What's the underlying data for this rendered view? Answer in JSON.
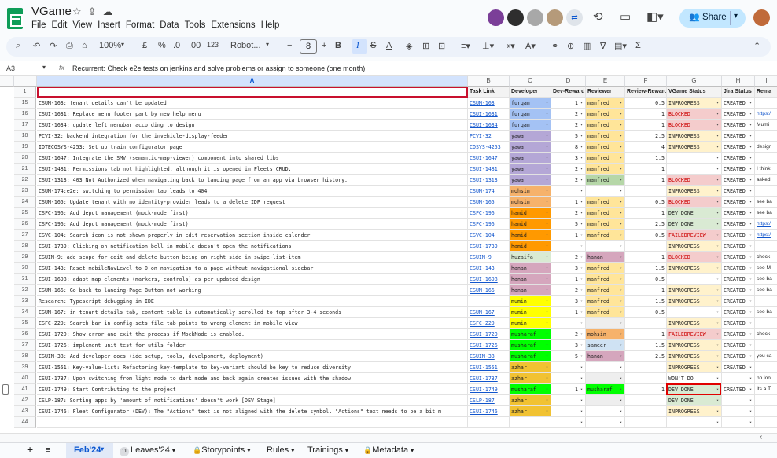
{
  "app": {
    "doc_title": "VGame",
    "menu": [
      "File",
      "Edit",
      "View",
      "Insert",
      "Format",
      "Data",
      "Tools",
      "Extensions",
      "Help"
    ],
    "share_label": "Share"
  },
  "toolbar": {
    "zoom": "100%",
    "currency": "£",
    "percent": "%",
    "decimals_dec": ".0",
    "decimals_inc": ".00",
    "number_format": "123",
    "font": "Robot...",
    "font_size": "8"
  },
  "formula_bar": {
    "cell_ref": "A3",
    "fx": "fx",
    "content": "Recurrent: Check e2e tests on jenkins and solve problems or assign to someone (one month)"
  },
  "columns": [
    "A",
    "B",
    "C",
    "D",
    "E",
    "F",
    "G",
    "H",
    "I"
  ],
  "header_row": {
    "row_num": "1",
    "task_link": "Task Link",
    "developer": "Developer",
    "dev_reward": "Dev-Reward",
    "reviewer": "Reviewer",
    "review_reward": "Review-Reward",
    "vgame_status": "VGame Status",
    "jira_status": "Jira Status",
    "remarks": "Rema"
  },
  "rows": [
    {
      "n": "15",
      "a": "CSUM-163: tenant details can't be updated",
      "b": "CSUM-163",
      "c": "furqan",
      "d": "1",
      "e": "manfred",
      "f": "0.5",
      "g": "INPROGRESS",
      "h": "CREATED",
      "i": ""
    },
    {
      "n": "16",
      "a": "CSUI-1631: Replace menu footer part by new help menu",
      "b": "CSUI-1631",
      "c": "furqan",
      "d": "2",
      "e": "manfred",
      "f": "1",
      "g": "BLOCKED",
      "h": "CREATED",
      "i": "https:/"
    },
    {
      "n": "17",
      "a": "CSUI-1634: update left menubar according to design",
      "b": "CSUI-1634",
      "c": "furqan",
      "d": "2",
      "e": "manfred",
      "f": "1",
      "g": "BLOCKED",
      "h": "CREATED",
      "i": "Mumi"
    },
    {
      "n": "18",
      "a": "PCVI-32: backend integration for the invehicle-display-feeder",
      "b": "PCVI-32",
      "c": "yawar",
      "d": "5",
      "e": "manfred",
      "f": "2.5",
      "g": "INPROGRESS",
      "h": "CREATED",
      "i": ""
    },
    {
      "n": "19",
      "a": "IOTECOSYS-4253: Set up train configurator page",
      "b": "COSYS-4253",
      "c": "yawar",
      "d": "8",
      "e": "manfred",
      "f": "4",
      "g": "INPROGRESS",
      "h": "CREATED",
      "i": "design"
    },
    {
      "n": "20",
      "a": "CSUI-1647: Integrate the SMV (semantic-map-viewer) component into shared libs",
      "b": "CSUI-1647",
      "c": "yawar",
      "d": "3",
      "e": "manfred",
      "f": "1.5",
      "g": "",
      "h": "CREATED",
      "i": ""
    },
    {
      "n": "21",
      "a": "CSUI-1481: Permissions tab not highlighted, although it is opened in Fleets CRUD.",
      "b": "CSUI-1481",
      "c": "yawar",
      "d": "2",
      "e": "manfred",
      "f": "1",
      "g": "",
      "h": "CREATED",
      "i": "I think"
    },
    {
      "n": "22",
      "a": "CSUI-1313: 403 Not Authorized when navigating back to landing page from an app via browser history.",
      "b": "CSUI-1313",
      "c": "yawar",
      "d": "2",
      "e": "manfred",
      "f": "1",
      "g": "BLOCKED",
      "h": "CREATED",
      "i": "asked"
    },
    {
      "n": "23",
      "a": "CSUM-174:e2e: switching to permission tab leads to 404",
      "b": "CSUM-174",
      "c": "mohsin",
      "d": "",
      "e": "",
      "f": "",
      "g": "INPROGRESS",
      "h": "CREATED",
      "i": ""
    },
    {
      "n": "24",
      "a": "CSUM-165: Update tenant with no identity-provider leads to a delete IDP request",
      "b": "CSUM-165",
      "c": "mohsin",
      "d": "1",
      "e": "manfred",
      "f": "0.5",
      "g": "BLOCKED",
      "h": "CREATED",
      "i": "see ba"
    },
    {
      "n": "25",
      "a": "CSFC-196: Add depot management (mock-mode first)",
      "b": "CSFC-196",
      "c": "hamid",
      "d": "2",
      "e": "manfred",
      "f": "1",
      "g": "DEV DONE",
      "h": "CREATED",
      "i": "see ba"
    },
    {
      "n": "26",
      "a": "CSFC-196: Add depot management (mock-mode first)",
      "b": "CSFC-196",
      "c": "hamid",
      "d": "5",
      "e": "manfred",
      "f": "2.5",
      "g": "DEV DONE",
      "h": "CREATED",
      "i": "https:/"
    },
    {
      "n": "27",
      "a": "CSVC-104: Search icon is not shown properly in edit reservation section inside calender",
      "b": "CSVC-104",
      "c": "hamid",
      "d": "1",
      "e": "manfred",
      "f": "0.5",
      "g": "FAILEDREVIEW",
      "h": "CREATED",
      "i": "https:/"
    },
    {
      "n": "28",
      "a": "CSUI-1739: Clicking on notification bell in mobile doesn't open the notifications",
      "b": "CSUI-1739",
      "c": "hamid",
      "d": "",
      "e": "",
      "f": "",
      "g": "INPROGRESS",
      "h": "CREATED",
      "i": ""
    },
    {
      "n": "29",
      "a": "CSUIM-9: add scope for edit and delete button being on right side in swipe-list-item",
      "b": "CSUIM-9",
      "c": "huzaifa",
      "d": "2",
      "e": "hanan",
      "f": "1",
      "g": "BLOCKED",
      "h": "CREATED",
      "i": "check"
    },
    {
      "n": "30",
      "a": "CSUI-143: Reset mobileNavLevel to 0 on navigation to a page without navigational sidebar",
      "b": "CSUI-143",
      "c": "hanan",
      "d": "3",
      "e": "manfred",
      "f": "1.5",
      "g": "INPROGRESS",
      "h": "CREATED",
      "i": "see M"
    },
    {
      "n": "31",
      "a": "CSUI-1698: adapt map elements (markers, controls) as per updated design",
      "b": "CSUI-1698",
      "c": "hanan",
      "d": "1",
      "e": "manfred",
      "f": "0.5",
      "g": "",
      "h": "CREATED",
      "i": "see ba"
    },
    {
      "n": "32",
      "a": "CSUM-166: Go back to landing-Page Button not working",
      "b": "CSUM-166",
      "c": "hanan",
      "d": "2",
      "e": "manfred",
      "f": "1",
      "g": "INPROGRESS",
      "h": "CREATED",
      "i": "see ba"
    },
    {
      "n": "33",
      "a": "Research: Typescript debugging in IDE",
      "b": "",
      "c": "mumin",
      "d": "3",
      "e": "manfred",
      "f": "1.5",
      "g": "INPROGRESS",
      "h": "CREATED",
      "i": ""
    },
    {
      "n": "34",
      "a": "CSUM-167: in tenant details tab, content table is automatically scrolled to top after 3-4 seconds",
      "b": "CSUM-167",
      "c": "mumin",
      "d": "1",
      "e": "manfred",
      "f": "0.5",
      "g": "",
      "h": "CREATED",
      "i": "see ba"
    },
    {
      "n": "35",
      "a": "CSFC-229: Search bar in config-sets file tab points to wrong element in mobile view",
      "b": "CSFC-229",
      "c": "mumin",
      "d": "",
      "e": "",
      "f": "",
      "g": "INPROGRESS",
      "h": "CREATED",
      "i": ""
    },
    {
      "n": "36",
      "a": "CSUI-1720: Show error and exit the process if MockMode is enabled.",
      "b": "CSUI-1720",
      "c": "musharaf",
      "d": "2",
      "e": "mohsin",
      "f": "1",
      "g": "FAILEDREVIEW",
      "h": "CREATED",
      "i": "check"
    },
    {
      "n": "37",
      "a": "CSUI-1726: implement unit test for utils folder",
      "b": "CSUI-1726",
      "c": "musharaf",
      "d": "3",
      "e": "sameer",
      "f": "1.5",
      "g": "INPROGRESS",
      "h": "CREATED",
      "i": ""
    },
    {
      "n": "38",
      "a": "CSUIM-38: Add developer docs (ide setup, tools, develpoment, deployment)",
      "b": "CSUIM-38",
      "c": "musharaf",
      "d": "5",
      "e": "hanan",
      "f": "2.5",
      "g": "INPROGRESS",
      "h": "CREATED",
      "i": "you ca"
    },
    {
      "n": "39",
      "a": "CSUI-1551: Key-value-list: Refactoring key-template to key-variant should be key to reduce diversity",
      "b": "CSUI-1551",
      "c": "azhar",
      "d": "",
      "e": "",
      "f": "",
      "g": "INPROGRESS",
      "h": "CREATED",
      "i": ""
    },
    {
      "n": "40",
      "a": "CSUI-1737: Upon switching from light mode to dark mode and back again creates issues with the shadow",
      "b": "CSUI-1737",
      "c": "azhar",
      "d": "",
      "e": "",
      "f": "",
      "g": "WON'T DO",
      "h": "",
      "i": "no lon"
    },
    {
      "n": "41",
      "a": "CSUI-1749: Start Contributing to the project",
      "b": "CSUI-1749",
      "c": "musharaf",
      "d": "1",
      "e": "musharaf",
      "f": "1",
      "g": "DEV DONE",
      "h": "CREATED",
      "i": "Its a T"
    },
    {
      "n": "42",
      "a": "CSLP-187: Sorting apps by 'amount of notifications' doesn't work [DEV Stage]",
      "b": "CSLP-187",
      "c": "azhar",
      "d": "",
      "e": "",
      "f": "",
      "g": "DEV DONE",
      "h": "",
      "i": ""
    },
    {
      "n": "43",
      "a": "CSUI-1746: Fleet Configurator (DEV): The \"Actions\" text is not aligned with the delete symbol. \"Actions\" text needs to be a bit m",
      "b": "CSUI-1746",
      "c": "azhar",
      "d": "",
      "e": "",
      "f": "",
      "g": "INPROGRESS",
      "h": "",
      "i": ""
    },
    {
      "n": "44",
      "a": "",
      "b": "",
      "c": "",
      "d": "",
      "e": "",
      "f": "",
      "g": "",
      "h": "",
      "i": ""
    }
  ],
  "sheet_tabs": {
    "add": "+",
    "list": "≡",
    "tabs": [
      "Feb'24",
      "Leaves'24",
      "Storypoints",
      "Rules",
      "Trainings",
      "Metadata"
    ],
    "leaves_badge": "11"
  },
  "colors": {
    "furqan": "#a4c2f4",
    "yawar": "#b4a7d6",
    "mohsin": "#f6b26b",
    "hamid": "#ff9900",
    "huzaifa": "#d9ead3",
    "hanan": "#d5a6bd",
    "mumin": "#ffff00",
    "musharaf": "#00ff00",
    "azhar": "#f1c232",
    "manfred": "#ffe599",
    "BLOCKED": "#f4cccc",
    "INPROGRESS": "#fff2cc",
    "DEV DONE": "#d9ead3",
    "FAILEDREVIEW": "#f4cccc",
    "WON'T DO": "#ffffff"
  }
}
